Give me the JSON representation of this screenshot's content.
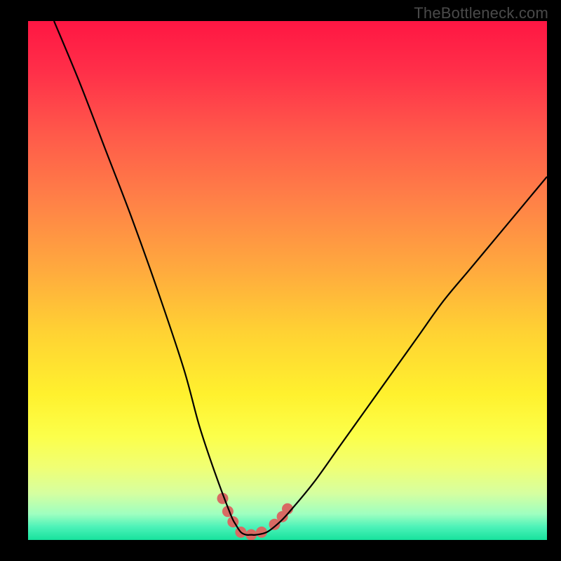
{
  "watermark": "TheBottleneck.com",
  "chart_data": {
    "type": "line",
    "title": "",
    "xlabel": "",
    "ylabel": "",
    "xlim": [
      0,
      100
    ],
    "ylim": [
      0,
      100
    ],
    "grid": false,
    "legend": false,
    "curve": {
      "name": "bottleneck_curve",
      "color": "#000000",
      "x": [
        5,
        10,
        15,
        20,
        25,
        30,
        33,
        36,
        39,
        40,
        41,
        42,
        43,
        44,
        46,
        48,
        50,
        55,
        60,
        65,
        70,
        75,
        80,
        85,
        90,
        95,
        100
      ],
      "y": [
        100,
        88,
        75,
        62,
        48,
        33,
        22,
        13,
        5,
        3,
        1.5,
        1,
        1,
        1,
        1.5,
        3,
        5,
        11,
        18,
        25,
        32,
        39,
        46,
        52,
        58,
        64,
        70
      ]
    },
    "highlight": {
      "name": "valley_markers",
      "color": "#d86a63",
      "radius_rel": 1.0,
      "x": [
        37.5,
        38.5,
        39.5,
        41.0,
        43.0,
        45.0,
        47.5,
        49.0,
        50.0
      ],
      "y": [
        8.0,
        5.5,
        3.5,
        1.5,
        1.0,
        1.5,
        3.0,
        4.5,
        6.0
      ]
    },
    "background_gradient": {
      "stops": [
        {
          "offset": 0.0,
          "color": "#ff1643"
        },
        {
          "offset": 0.1,
          "color": "#ff3049"
        },
        {
          "offset": 0.22,
          "color": "#ff5a4a"
        },
        {
          "offset": 0.35,
          "color": "#ff8247"
        },
        {
          "offset": 0.48,
          "color": "#ffaa3e"
        },
        {
          "offset": 0.6,
          "color": "#ffd233"
        },
        {
          "offset": 0.72,
          "color": "#fff12e"
        },
        {
          "offset": 0.8,
          "color": "#fcff4a"
        },
        {
          "offset": 0.86,
          "color": "#f0ff74"
        },
        {
          "offset": 0.91,
          "color": "#d6ffa0"
        },
        {
          "offset": 0.95,
          "color": "#9effc0"
        },
        {
          "offset": 0.975,
          "color": "#4cf2b8"
        },
        {
          "offset": 1.0,
          "color": "#17e29d"
        }
      ]
    }
  }
}
